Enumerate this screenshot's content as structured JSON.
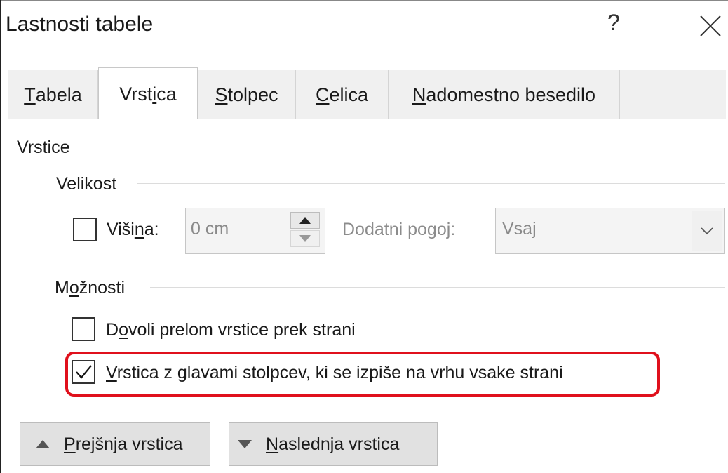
{
  "window": {
    "title": "Lastnosti tabele",
    "help_glyph": "?",
    "close_icon": "close-icon"
  },
  "tabs": [
    {
      "pre": "",
      "key": "T",
      "post": "abela",
      "active": false
    },
    {
      "pre": "Vrst",
      "key": "i",
      "post": "ca",
      "active": true
    },
    {
      "pre": "",
      "key": "S",
      "post": "tolpec",
      "active": false
    },
    {
      "pre": "",
      "key": "C",
      "post": "elica",
      "active": false
    },
    {
      "pre": "",
      "key": "N",
      "post": "adomestno besedilo",
      "active": false
    }
  ],
  "rows_section": {
    "label": "Vrstice"
  },
  "size_group": {
    "label": "Velikost",
    "height_checkbox": {
      "checked": false,
      "pre": "Viši",
      "key": "n",
      "post": "a:"
    },
    "height_value": "0 cm",
    "condition_label": "Dodatni pogoj:",
    "condition_value": "Vsaj"
  },
  "options_group": {
    "label_pre": "M",
    "label_key": "o",
    "label_post": "žnosti",
    "allow_break": {
      "checked": false,
      "pre": "D",
      "key": "o",
      "post": "voli prelom vrstice prek strani"
    },
    "repeat_header": {
      "checked": true,
      "pre": "",
      "key": "V",
      "post": "rstica z glavami stolpcev, ki se izpiše na vrhu vsake strani"
    }
  },
  "nav_buttons": {
    "prev": {
      "pre": "",
      "key": "P",
      "post": "rejšnja vrstica"
    },
    "next": {
      "pre": "",
      "key": "N",
      "post": "aslednja vrstica"
    }
  },
  "colors": {
    "highlight": "#e0101c",
    "tab_bg": "#f0f0f0",
    "button_bg": "#e1e1e1",
    "disabled_text": "#8a8a8a"
  }
}
